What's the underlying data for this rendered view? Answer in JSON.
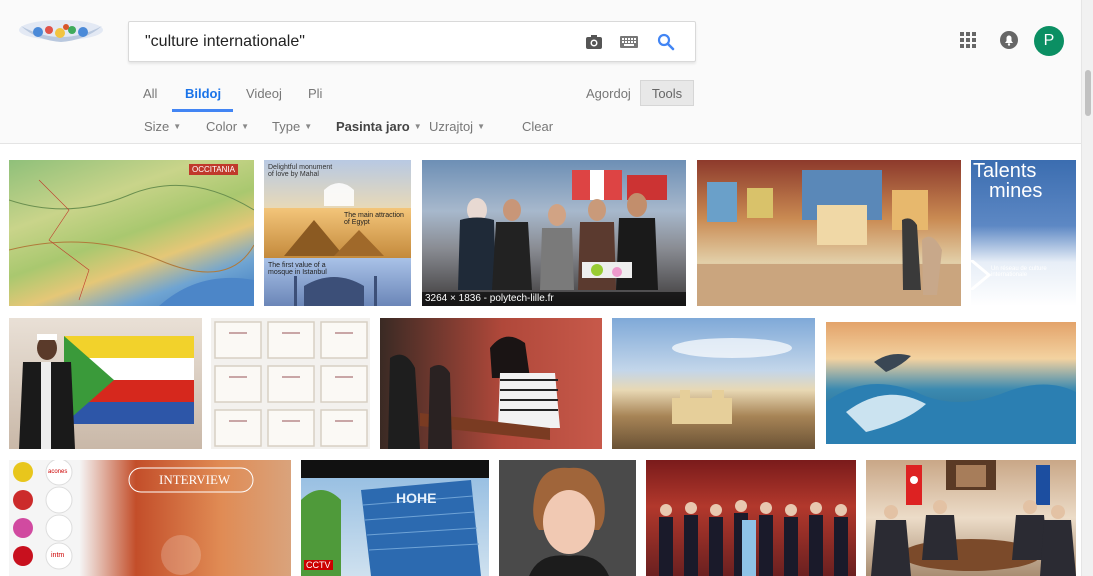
{
  "search": {
    "query": "\"culture internationale\""
  },
  "header": {
    "avatar_letter": "P"
  },
  "tabs": [
    {
      "label": "All",
      "active": false
    },
    {
      "label": "Bildoj",
      "active": true
    },
    {
      "label": "Videoj",
      "active": false
    },
    {
      "label": "Pli",
      "active": false
    }
  ],
  "settings_label": "Agordoj",
  "tools_label": "Tools",
  "filters": [
    {
      "label": "Size"
    },
    {
      "label": "Color"
    },
    {
      "label": "Type"
    },
    {
      "label": "Pasinta jaro"
    },
    {
      "label": "Uzrajtoj"
    },
    {
      "label": "Clear"
    }
  ],
  "results": [
    {
      "text": "OCCITANIA",
      "caption": ""
    },
    {
      "text": "Delightful monument of love by Mahal",
      "text2": "The main attraction of Egypt",
      "text3": "The first value of a mosque in Istanbul",
      "caption": ""
    },
    {
      "caption": "3264 × 1836 - polytech-lille.fr"
    },
    {
      "caption": ""
    },
    {
      "text": "Talents",
      "text2": "mines",
      "text3": "Un réseau de culture internationale",
      "caption": ""
    },
    {
      "caption": ""
    },
    {
      "caption": ""
    },
    {
      "caption": ""
    },
    {
      "caption": ""
    },
    {
      "caption": ""
    },
    {
      "text": "INTERVIEW",
      "text2": "acones",
      "text3": "intm",
      "caption": ""
    },
    {
      "text": "HOHE",
      "text2": "CCTV",
      "caption": ""
    },
    {
      "caption": ""
    },
    {
      "caption": ""
    },
    {
      "caption": ""
    }
  ],
  "colors": {
    "accent": "#4285f4",
    "avatar_bg": "#0b8f63"
  },
  "icons": [
    "camera-icon",
    "keyboard-icon",
    "search-icon",
    "apps-grid-icon",
    "notifications-icon"
  ]
}
